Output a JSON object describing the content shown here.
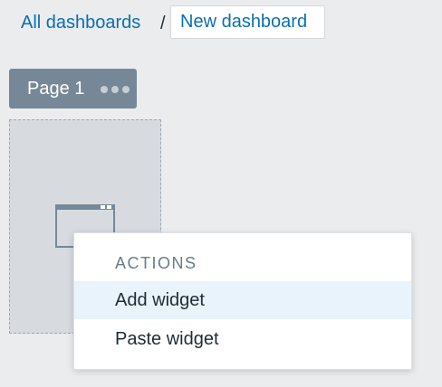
{
  "breadcrumb": {
    "parent_label": "All dashboards",
    "separator": "/",
    "current_title": "New dashboard"
  },
  "page_tab": {
    "label": "Page 1",
    "menu_icon": "more-horizontal-icon"
  },
  "canvas": {
    "placeholder_icon": "widget-window-icon"
  },
  "context_menu": {
    "heading": "ACTIONS",
    "items": [
      {
        "label": "Add widget",
        "highlighted": true
      },
      {
        "label": "Paste widget",
        "highlighted": false
      }
    ]
  },
  "colors": {
    "background": "#ebecee",
    "link": "#0a6fb3",
    "tab": "#768898",
    "menu_highlight": "#e8f3fc"
  }
}
